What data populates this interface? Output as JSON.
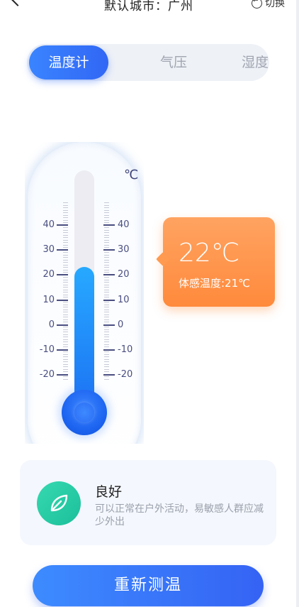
{
  "header": {
    "title": "默认城市：广州",
    "switch_label": "切换"
  },
  "tabs": [
    {
      "label": "温度计",
      "active": true
    },
    {
      "label": "气压",
      "active": false
    },
    {
      "label": "湿度",
      "active": false
    }
  ],
  "thermometer": {
    "unit": "℃",
    "scale_labels": [
      "40",
      "30",
      "20",
      "10",
      "0",
      "-10",
      "-20"
    ],
    "current_level_celsius": 22
  },
  "bubble": {
    "temperature": "22℃",
    "feels_like": "体感温度:21℃"
  },
  "status_card": {
    "title": "良好",
    "description": "可以正常在户外活动，易敏感人群应减少外出",
    "icon": "leaf-icon"
  },
  "button": {
    "label": "重新测温"
  },
  "colors": {
    "accent_blue": "#3167f5",
    "bubble_orange": "#ff8a3c",
    "leaf_green": "#1bbf9a"
  }
}
